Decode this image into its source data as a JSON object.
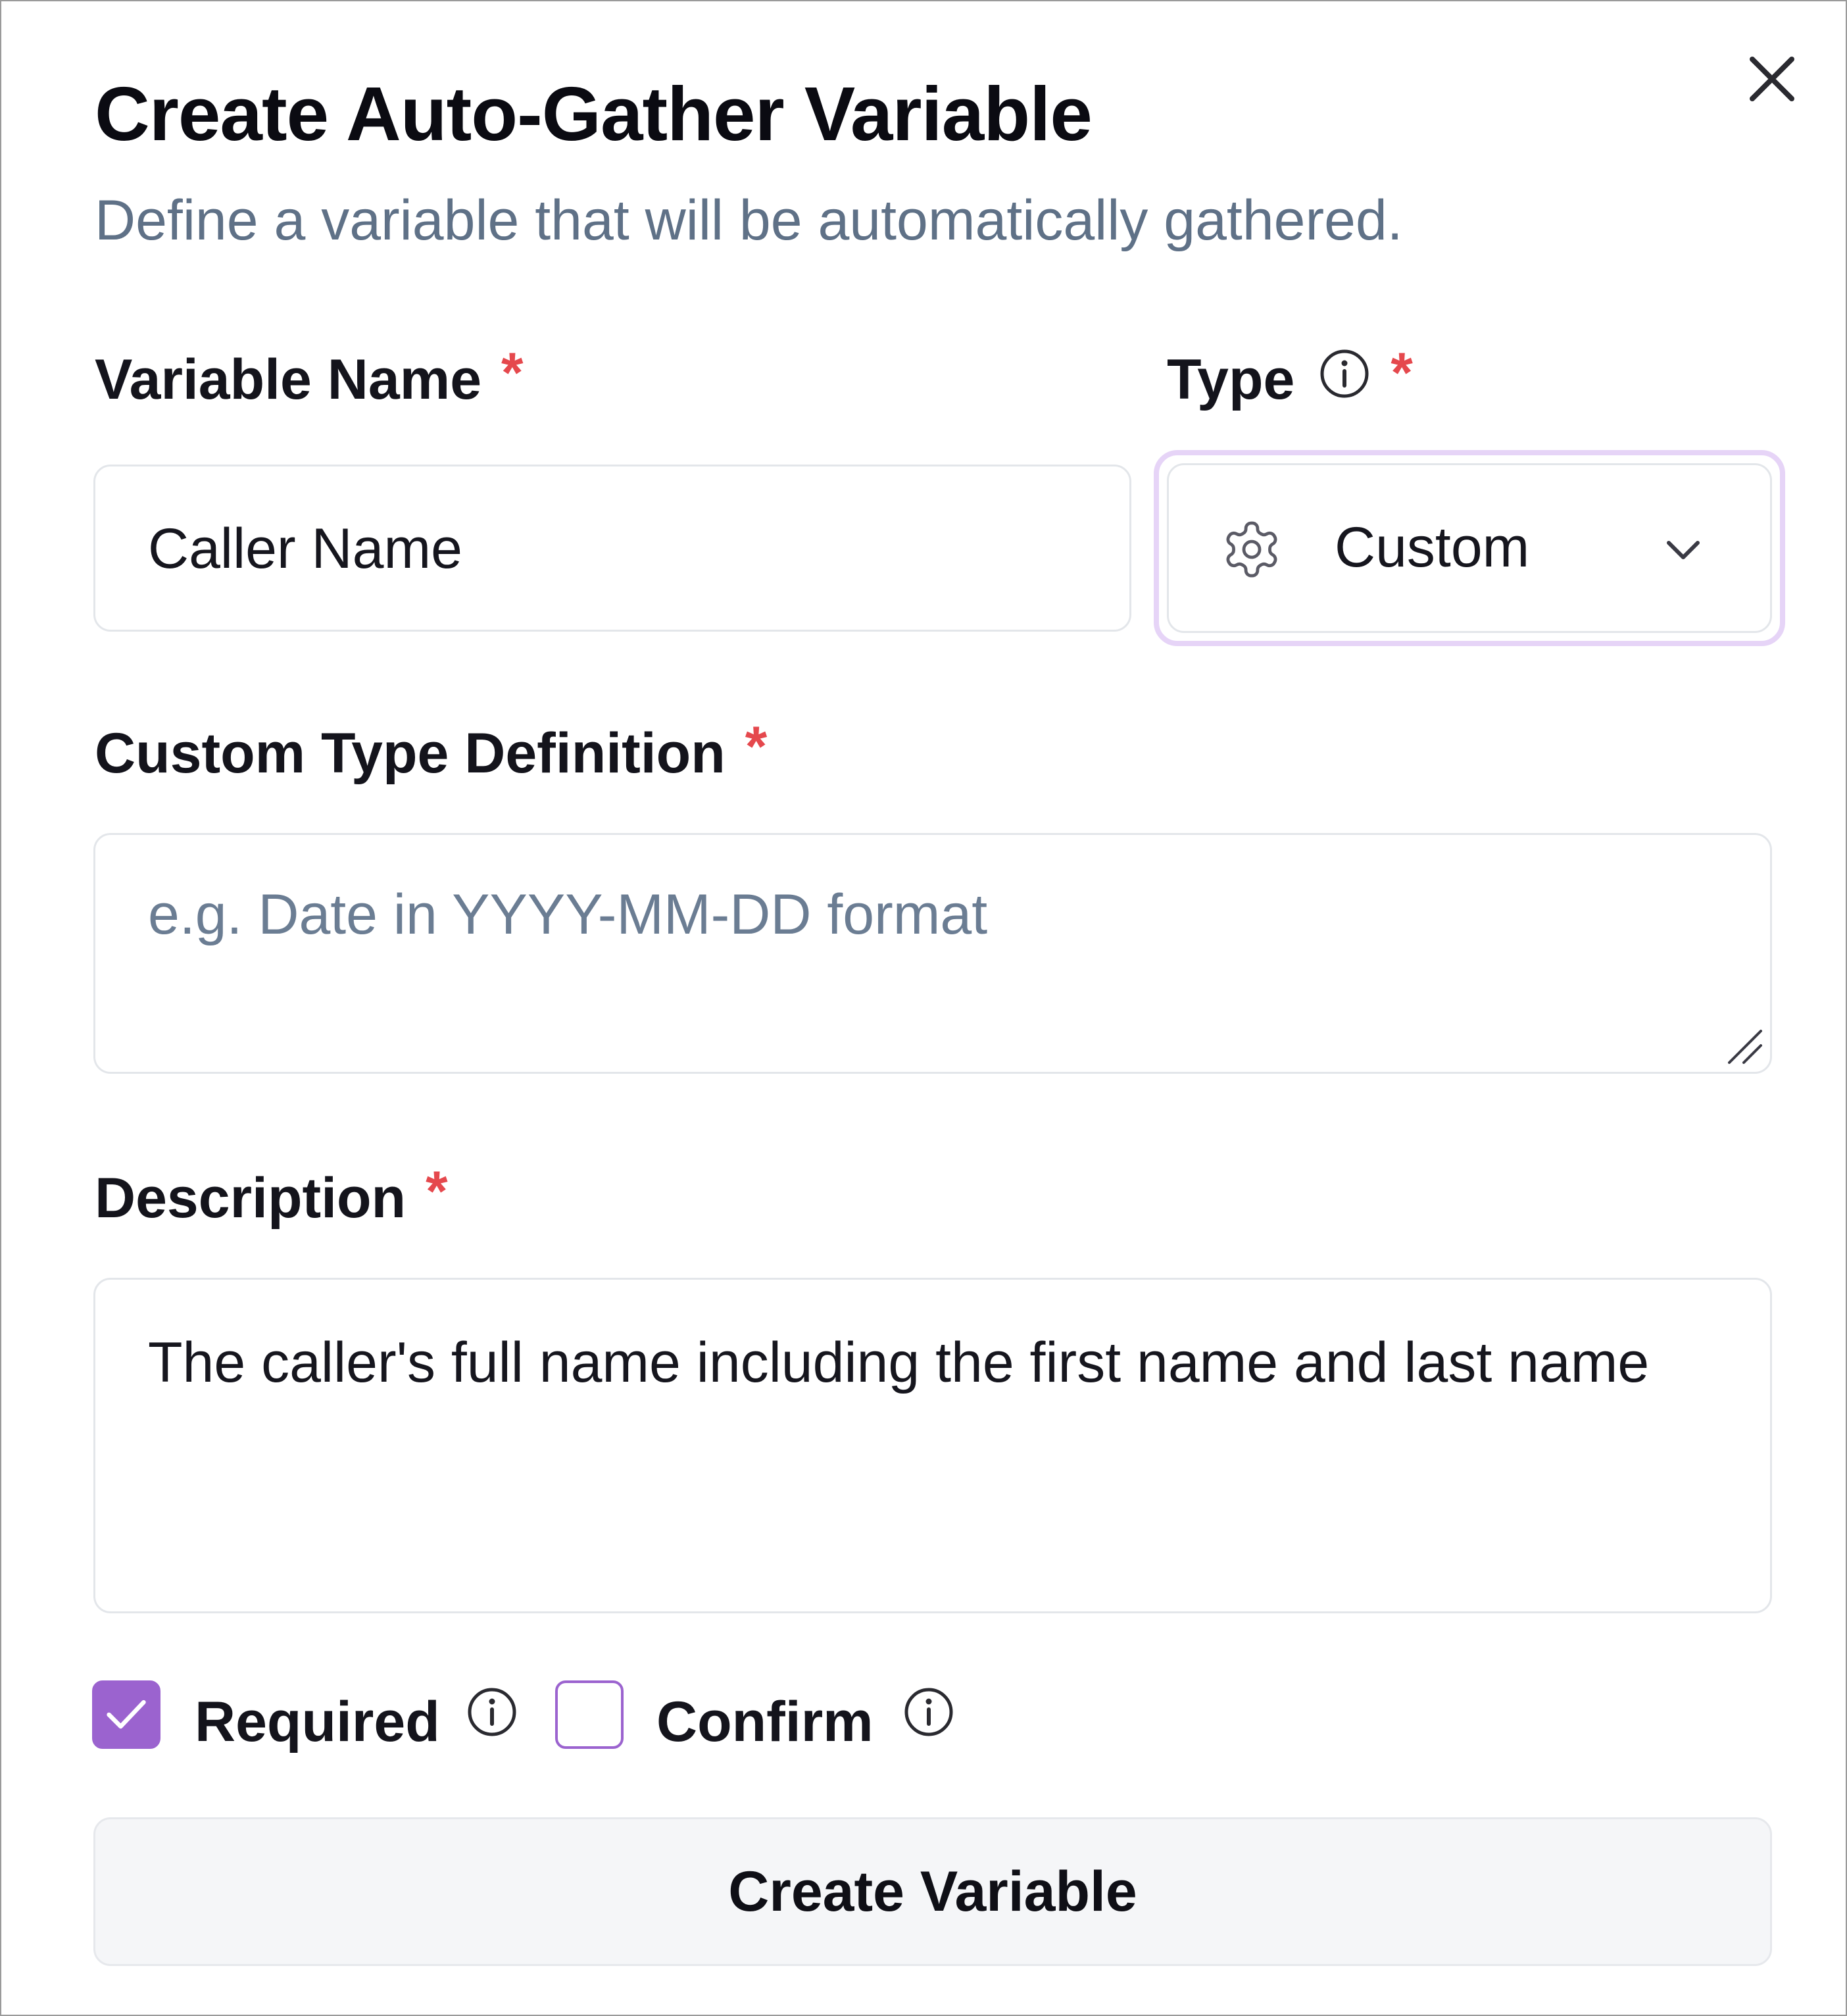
{
  "dialog": {
    "title": "Create Auto-Gather Variable",
    "subtitle": "Define a variable that will be automatically gathered.",
    "close_icon": "close-icon"
  },
  "fields": {
    "variable_name": {
      "label": "Variable Name",
      "required_mark": "*",
      "value": "Caller Name"
    },
    "type": {
      "label": "Type",
      "required_mark": "*",
      "info_icon": "info-icon",
      "selected": "Custom",
      "selected_icon": "gear-icon",
      "dropdown_icon": "chevron-down-icon"
    },
    "custom_type_definition": {
      "label": "Custom Type Definition",
      "required_mark": "*",
      "value": "",
      "placeholder": "e.g. Date in YYYY-MM-DD format"
    },
    "description": {
      "label": "Description",
      "required_mark": "*",
      "value": "The caller's full name including the first name and last name"
    }
  },
  "options": {
    "required": {
      "label": "Required",
      "checked": true,
      "info_icon": "info-icon"
    },
    "confirm": {
      "label": "Confirm",
      "checked": false,
      "info_icon": "info-icon"
    }
  },
  "actions": {
    "create_label": "Create Variable"
  },
  "colors": {
    "accent": "#9b63cf",
    "focus_ring": "#e6d4f7",
    "required_star": "#e5484d",
    "muted_text": "#5f7187"
  }
}
